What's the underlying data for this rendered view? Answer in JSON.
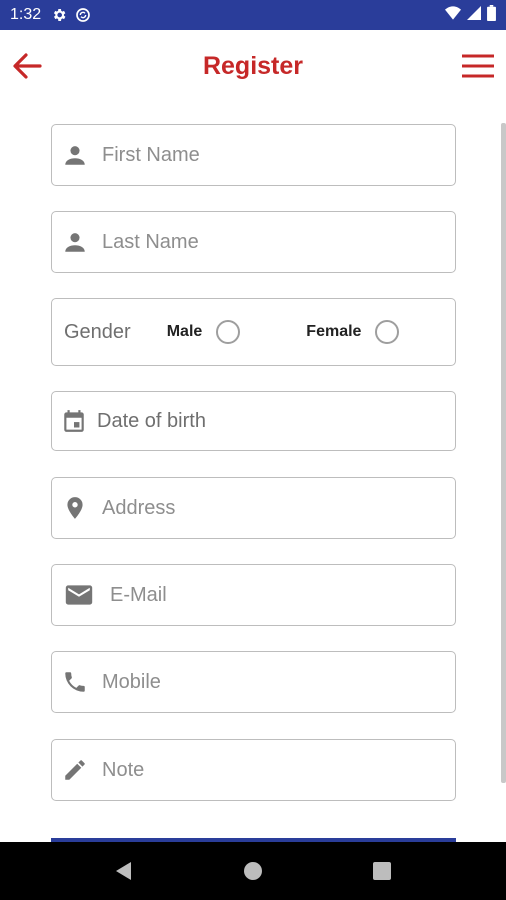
{
  "status_bar": {
    "time": "1:32",
    "icons": [
      "settings-icon",
      "sync-icon",
      "wifi-icon",
      "signal-icon",
      "battery-icon"
    ]
  },
  "app_bar": {
    "title": "Register",
    "back_icon": "arrow-left-icon",
    "menu_icon": "hamburger-menu-icon",
    "accent_color": "#c62828"
  },
  "form": {
    "first_name": {
      "placeholder": "First Name",
      "icon": "person-icon"
    },
    "last_name": {
      "placeholder": "Last Name",
      "icon": "person-icon"
    },
    "gender": {
      "label": "Gender",
      "options": [
        "Male",
        "Female"
      ]
    },
    "date_of_birth": {
      "placeholder": "Date of birth",
      "icon": "calendar-icon"
    },
    "address": {
      "placeholder": "Address",
      "icon": "location-pin-icon"
    },
    "email": {
      "placeholder": "E-Mail",
      "icon": "mail-icon"
    },
    "mobile": {
      "placeholder": "Mobile",
      "icon": "phone-icon"
    },
    "note": {
      "placeholder": "Note",
      "icon": "pencil-icon"
    }
  },
  "colors": {
    "status_bar": "#2a3d9a",
    "icon_gray": "#757575",
    "border": "#bdbdbd"
  },
  "nav_bar": {
    "buttons": [
      "back-triangle-icon",
      "home-circle-icon",
      "recents-square-icon"
    ]
  }
}
